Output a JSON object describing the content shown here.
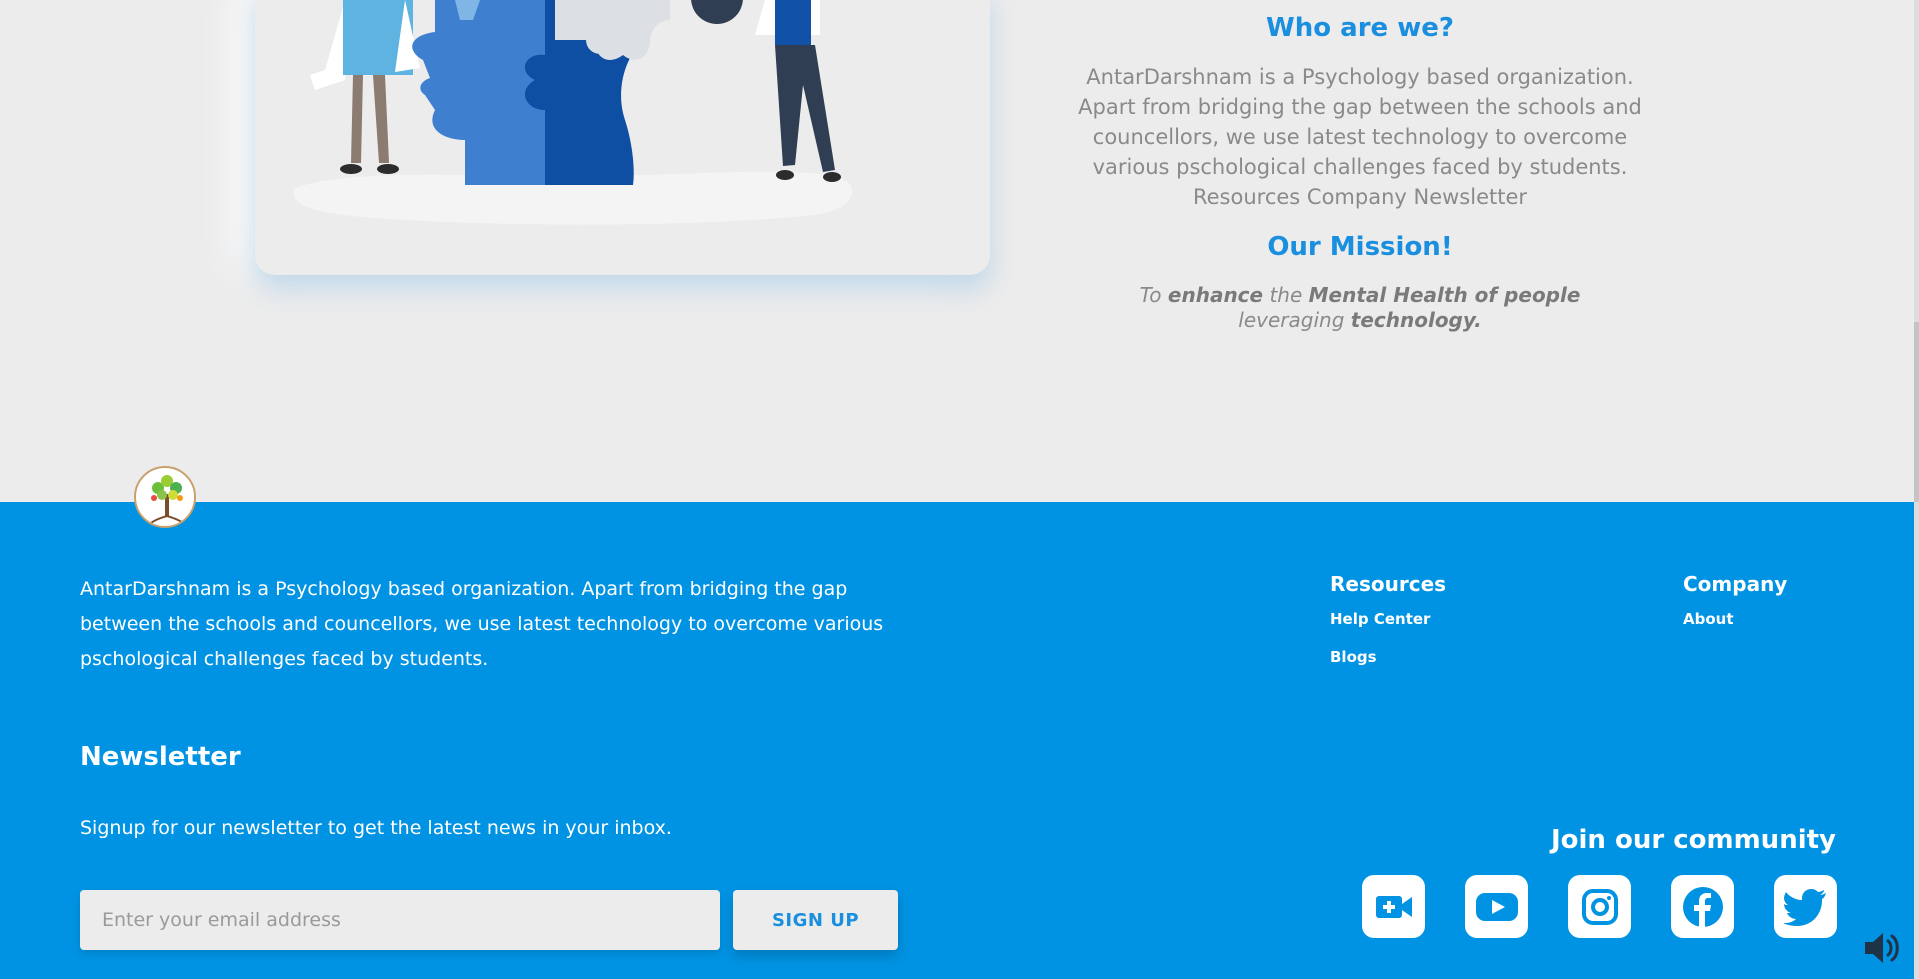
{
  "about": {
    "who_title": "Who are we?",
    "who_lines": [
      "AntarDarshnam is a Psychology based organization.",
      "Apart from bridging the gap between the schools and",
      "councellors, we use latest technology to overcome",
      "various pschological challenges faced by students.",
      "Resources Company Newsletter"
    ],
    "mission_title": "Our Mission!",
    "mission": {
      "p1": "To ",
      "b1": "enhance",
      "p2": " the ",
      "b2": "Mental Health of people",
      "p3": " leveraging ",
      "b3": "technology."
    }
  },
  "footer": {
    "about_text": "AntarDarshnam is a Psychology based organization. Apart from bridging the gap between the schools and councellors, we use latest technology to overcome various pschological challenges faced by students.",
    "newsletter_title": "Newsletter",
    "newsletter_sub": "Signup for our newsletter to get the latest news in your inbox.",
    "email_placeholder": "Enter your email address",
    "signup_label": "SIGN UP",
    "resources": {
      "title": "Resources",
      "links": [
        "Help Center",
        "Blogs"
      ]
    },
    "company": {
      "title": "Company",
      "links": [
        "About"
      ]
    },
    "community_title": "Join our community",
    "social_icons": [
      "video-call-icon",
      "youtube-icon",
      "instagram-icon",
      "facebook-icon",
      "twitter-icon"
    ]
  },
  "colors": {
    "footer_bg": "#0193e3",
    "accent": "#1a8fdf",
    "page_bg": "#ececec",
    "body_text": "#8a8a8a"
  }
}
